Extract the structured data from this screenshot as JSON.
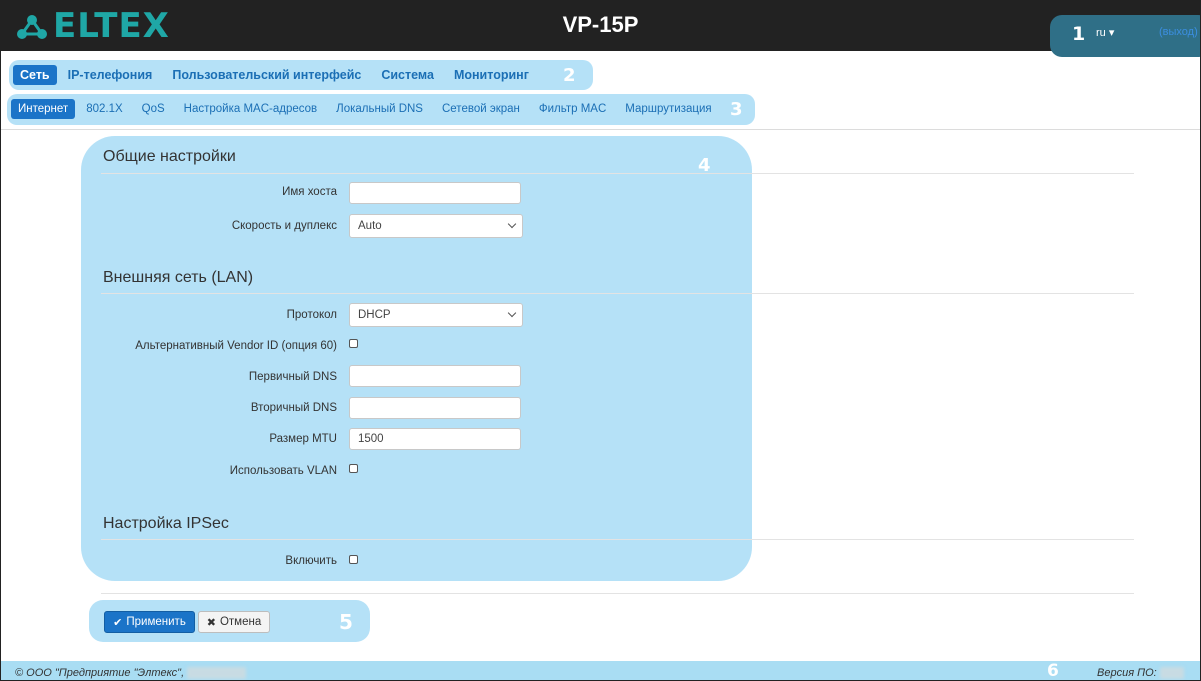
{
  "header": {
    "logo_text": "ELTEX",
    "device_title": "VP-15P",
    "language": "ru ▾",
    "logout": "(выход)"
  },
  "main_nav": {
    "tabs": [
      {
        "label": "Сеть",
        "active": true
      },
      {
        "label": "IP-телефония",
        "active": false
      },
      {
        "label": "Пользовательский интерфейс",
        "active": false
      },
      {
        "label": "Система",
        "active": false
      },
      {
        "label": "Мониторинг",
        "active": false
      }
    ]
  },
  "sub_nav": {
    "tabs": [
      {
        "label": "Интернет",
        "active": true
      },
      {
        "label": "802.1X",
        "active": false
      },
      {
        "label": "QoS",
        "active": false
      },
      {
        "label": "Настройка MAC-адресов",
        "active": false
      },
      {
        "label": "Локальный DNS",
        "active": false
      },
      {
        "label": "Сетевой экран",
        "active": false
      },
      {
        "label": "Фильтр MAC",
        "active": false
      },
      {
        "label": "Маршрутизация",
        "active": false
      }
    ]
  },
  "annotations": [
    "1",
    "2",
    "3",
    "4",
    "5",
    "6"
  ],
  "general": {
    "title": "Общие настройки",
    "hostname_label": "Имя хоста",
    "hostname_value": "",
    "speed_label": "Скорость и дуплекс",
    "speed_value": "Auto"
  },
  "lan": {
    "title": "Внешняя сеть (LAN)",
    "protocol_label": "Протокол",
    "protocol_value": "DHCP",
    "vendor_id_label": "Альтернативный Vendor ID (опция 60)",
    "vendor_id_checked": false,
    "dns1_label": "Первичный DNS",
    "dns1_value": "",
    "dns2_label": "Вторичный DNS",
    "dns2_value": "",
    "mtu_label": "Размер MTU",
    "mtu_value": "1500",
    "vlan_label": "Использовать VLAN",
    "vlan_checked": false
  },
  "ipsec": {
    "title": "Настройка IPSec",
    "enable_label": "Включить",
    "enable_checked": false
  },
  "actions": {
    "apply_label": "Применить",
    "cancel_label": "Отмена"
  },
  "footer": {
    "copyright": "© ООО \"Предприятие \"Элтекс\",",
    "version_label": "Версия ПО:"
  },
  "colors": {
    "topbar": "#222222",
    "accent": "#1b74c8",
    "logo": "#1fa7a6",
    "annotation": "#78c8f0"
  }
}
